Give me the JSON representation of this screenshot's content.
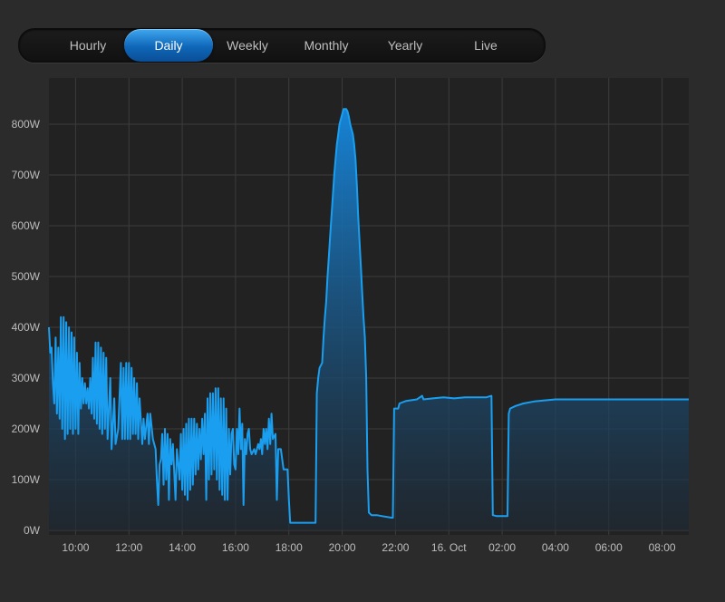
{
  "tabs": [
    {
      "label": "Hourly",
      "active": false
    },
    {
      "label": "Daily",
      "active": true
    },
    {
      "label": "Weekly",
      "active": false
    },
    {
      "label": "Monthly",
      "active": false
    },
    {
      "label": "Yearly",
      "active": false
    },
    {
      "label": "Live",
      "active": false
    }
  ],
  "colors": {
    "line": "#1a9ff0",
    "fill_top": "#1683d6",
    "fill_bottom": "#1e2a36",
    "plot_bg": "#222222",
    "grid": "#3c3c3c",
    "active_tab": "#1677c9"
  },
  "chart_data": {
    "type": "area",
    "grid": true,
    "legend": "none",
    "x_unit": "hours since 09:00",
    "xlim": [
      0,
      24
    ],
    "ylim": [
      0,
      900
    ],
    "y_ticks": [
      0,
      100,
      200,
      300,
      400,
      500,
      600,
      700,
      800
    ],
    "y_tick_labels": [
      "0W",
      "100W",
      "200W",
      "300W",
      "400W",
      "500W",
      "600W",
      "700W",
      "800W"
    ],
    "x_ticks": [
      1,
      3,
      5,
      7,
      9,
      11,
      13,
      15,
      17,
      19,
      21,
      23
    ],
    "x_tick_labels": [
      "10:00",
      "12:00",
      "14:00",
      "16:00",
      "18:00",
      "20:00",
      "22:00",
      "16. Oct",
      "02:00",
      "04:00",
      "06:00",
      "08:00"
    ],
    "series": [
      {
        "points": [
          [
            0.0,
            400
          ],
          [
            0.05,
            350
          ],
          [
            0.1,
            360
          ],
          [
            0.15,
            290
          ],
          [
            0.2,
            250
          ],
          [
            0.25,
            380
          ],
          [
            0.3,
            230
          ],
          [
            0.35,
            360
          ],
          [
            0.4,
            220
          ],
          [
            0.45,
            420
          ],
          [
            0.5,
            200
          ],
          [
            0.55,
            420
          ],
          [
            0.6,
            180
          ],
          [
            0.65,
            410
          ],
          [
            0.7,
            190
          ],
          [
            0.75,
            400
          ],
          [
            0.8,
            200
          ],
          [
            0.85,
            390
          ],
          [
            0.9,
            190
          ],
          [
            0.95,
            380
          ],
          [
            1.0,
            200
          ],
          [
            1.05,
            350
          ],
          [
            1.1,
            190
          ],
          [
            1.15,
            330
          ],
          [
            1.2,
            240
          ],
          [
            1.25,
            300
          ],
          [
            1.3,
            250
          ],
          [
            1.35,
            290
          ],
          [
            1.4,
            250
          ],
          [
            1.45,
            280
          ],
          [
            1.5,
            240
          ],
          [
            1.55,
            300
          ],
          [
            1.6,
            230
          ],
          [
            1.65,
            340
          ],
          [
            1.7,
            220
          ],
          [
            1.75,
            370
          ],
          [
            1.8,
            210
          ],
          [
            1.85,
            370
          ],
          [
            1.9,
            200
          ],
          [
            1.95,
            360
          ],
          [
            2.0,
            190
          ],
          [
            2.05,
            350
          ],
          [
            2.1,
            200
          ],
          [
            2.15,
            340
          ],
          [
            2.2,
            180
          ],
          [
            2.3,
            300
          ],
          [
            2.35,
            160
          ],
          [
            2.45,
            260
          ],
          [
            2.5,
            170
          ],
          [
            2.6,
            200
          ],
          [
            2.7,
            330
          ],
          [
            2.75,
            180
          ],
          [
            2.8,
            320
          ],
          [
            2.85,
            180
          ],
          [
            2.9,
            330
          ],
          [
            2.95,
            180
          ],
          [
            3.0,
            330
          ],
          [
            3.05,
            180
          ],
          [
            3.1,
            320
          ],
          [
            3.15,
            190
          ],
          [
            3.2,
            300
          ],
          [
            3.25,
            190
          ],
          [
            3.3,
            290
          ],
          [
            3.35,
            180
          ],
          [
            3.4,
            260
          ],
          [
            3.5,
            170
          ],
          [
            3.55,
            220
          ],
          [
            3.6,
            180
          ],
          [
            3.7,
            230
          ],
          [
            3.75,
            170
          ],
          [
            3.8,
            230
          ],
          [
            3.9,
            180
          ],
          [
            4.0,
            160
          ],
          [
            4.05,
            100
          ],
          [
            4.1,
            50
          ],
          [
            4.15,
            130
          ],
          [
            4.2,
            140
          ],
          [
            4.25,
            190
          ],
          [
            4.3,
            90
          ],
          [
            4.35,
            200
          ],
          [
            4.4,
            100
          ],
          [
            4.45,
            190
          ],
          [
            4.5,
            60
          ],
          [
            4.55,
            180
          ],
          [
            4.6,
            130
          ],
          [
            4.65,
            170
          ],
          [
            4.75,
            60
          ],
          [
            4.8,
            160
          ],
          [
            4.85,
            130
          ],
          [
            4.9,
            100
          ],
          [
            4.95,
            190
          ],
          [
            5.0,
            80
          ],
          [
            5.05,
            200
          ],
          [
            5.1,
            70
          ],
          [
            5.15,
            210
          ],
          [
            5.2,
            60
          ],
          [
            5.25,
            220
          ],
          [
            5.3,
            80
          ],
          [
            5.35,
            220
          ],
          [
            5.4,
            90
          ],
          [
            5.45,
            220
          ],
          [
            5.5,
            110
          ],
          [
            5.55,
            210
          ],
          [
            5.6,
            120
          ],
          [
            5.65,
            200
          ],
          [
            5.7,
            140
          ],
          [
            5.75,
            220
          ],
          [
            5.8,
            150
          ],
          [
            5.85,
            230
          ],
          [
            5.9,
            60
          ],
          [
            5.95,
            260
          ],
          [
            6.0,
            100
          ],
          [
            6.05,
            270
          ],
          [
            6.1,
            110
          ],
          [
            6.15,
            270
          ],
          [
            6.2,
            120
          ],
          [
            6.25,
            280
          ],
          [
            6.3,
            100
          ],
          [
            6.35,
            280
          ],
          [
            6.4,
            80
          ],
          [
            6.45,
            260
          ],
          [
            6.5,
            70
          ],
          [
            6.55,
            260
          ],
          [
            6.6,
            60
          ],
          [
            6.65,
            240
          ],
          [
            6.7,
            60
          ],
          [
            6.75,
            200
          ],
          [
            6.8,
            110
          ],
          [
            6.85,
            190
          ],
          [
            6.9,
            200
          ],
          [
            6.95,
            130
          ],
          [
            7.0,
            120
          ],
          [
            7.05,
            200
          ],
          [
            7.1,
            150
          ],
          [
            7.15,
            240
          ],
          [
            7.2,
            160
          ],
          [
            7.25,
            210
          ],
          [
            7.3,
            50
          ],
          [
            7.35,
            180
          ],
          [
            7.4,
            150
          ],
          [
            7.45,
            190
          ],
          [
            7.5,
            200
          ],
          [
            7.55,
            160
          ],
          [
            7.6,
            150
          ],
          [
            7.7,
            160
          ],
          [
            7.75,
            150
          ],
          [
            7.8,
            160
          ],
          [
            7.85,
            170
          ],
          [
            7.9,
            160
          ],
          [
            7.95,
            180
          ],
          [
            8.0,
            150
          ],
          [
            8.05,
            200
          ],
          [
            8.1,
            170
          ],
          [
            8.15,
            200
          ],
          [
            8.2,
            160
          ],
          [
            8.25,
            220
          ],
          [
            8.3,
            170
          ],
          [
            8.35,
            230
          ],
          [
            8.4,
            180
          ],
          [
            8.5,
            190
          ],
          [
            8.55,
            60
          ],
          [
            8.6,
            160
          ],
          [
            8.7,
            160
          ],
          [
            8.8,
            120
          ],
          [
            8.95,
            120
          ],
          [
            9.0,
            60
          ],
          [
            9.05,
            15
          ],
          [
            9.3,
            15
          ],
          [
            9.6,
            15
          ],
          [
            9.9,
            15
          ],
          [
            10.0,
            15
          ],
          [
            10.05,
            270
          ],
          [
            10.1,
            300
          ],
          [
            10.15,
            320
          ],
          [
            10.25,
            330
          ],
          [
            10.3,
            380
          ],
          [
            10.35,
            420
          ],
          [
            10.4,
            450
          ],
          [
            10.45,
            500
          ],
          [
            10.5,
            540
          ],
          [
            10.55,
            580
          ],
          [
            10.6,
            620
          ],
          [
            10.65,
            660
          ],
          [
            10.7,
            700
          ],
          [
            10.75,
            730
          ],
          [
            10.8,
            760
          ],
          [
            10.85,
            780
          ],
          [
            10.9,
            800
          ],
          [
            10.95,
            810
          ],
          [
            11.0,
            820
          ],
          [
            11.05,
            830
          ],
          [
            11.15,
            830
          ],
          [
            11.2,
            825
          ],
          [
            11.25,
            815
          ],
          [
            11.3,
            800
          ],
          [
            11.35,
            790
          ],
          [
            11.4,
            780
          ],
          [
            11.45,
            760
          ],
          [
            11.5,
            730
          ],
          [
            11.55,
            680
          ],
          [
            11.6,
            620
          ],
          [
            11.65,
            570
          ],
          [
            11.7,
            520
          ],
          [
            11.75,
            470
          ],
          [
            11.8,
            420
          ],
          [
            11.85,
            380
          ],
          [
            11.9,
            300
          ],
          [
            11.95,
            120
          ],
          [
            12.0,
            35
          ],
          [
            12.1,
            30
          ],
          [
            12.3,
            30
          ],
          [
            12.5,
            28
          ],
          [
            12.85,
            25
          ],
          [
            12.9,
            25
          ],
          [
            12.95,
            240
          ],
          [
            13.1,
            240
          ],
          [
            13.15,
            250
          ],
          [
            13.4,
            255
          ],
          [
            13.8,
            258
          ],
          [
            14.0,
            265
          ],
          [
            14.05,
            258
          ],
          [
            14.4,
            260
          ],
          [
            14.8,
            262
          ],
          [
            15.2,
            260
          ],
          [
            15.6,
            262
          ],
          [
            16.0,
            262
          ],
          [
            16.4,
            262
          ],
          [
            16.6,
            265
          ],
          [
            16.65,
            30
          ],
          [
            16.8,
            28
          ],
          [
            17.0,
            28
          ],
          [
            17.2,
            28
          ],
          [
            17.25,
            230
          ],
          [
            17.3,
            240
          ],
          [
            17.5,
            245
          ],
          [
            17.8,
            250
          ],
          [
            18.2,
            254
          ],
          [
            18.6,
            256
          ],
          [
            19.0,
            258
          ],
          [
            19.4,
            258
          ],
          [
            19.8,
            258
          ],
          [
            20.2,
            258
          ],
          [
            20.6,
            258
          ],
          [
            21.0,
            258
          ],
          [
            21.4,
            258
          ],
          [
            21.8,
            258
          ],
          [
            22.2,
            258
          ],
          [
            22.6,
            258
          ],
          [
            23.0,
            258
          ],
          [
            23.4,
            258
          ],
          [
            23.7,
            258
          ],
          [
            24.0,
            258
          ]
        ]
      }
    ]
  }
}
